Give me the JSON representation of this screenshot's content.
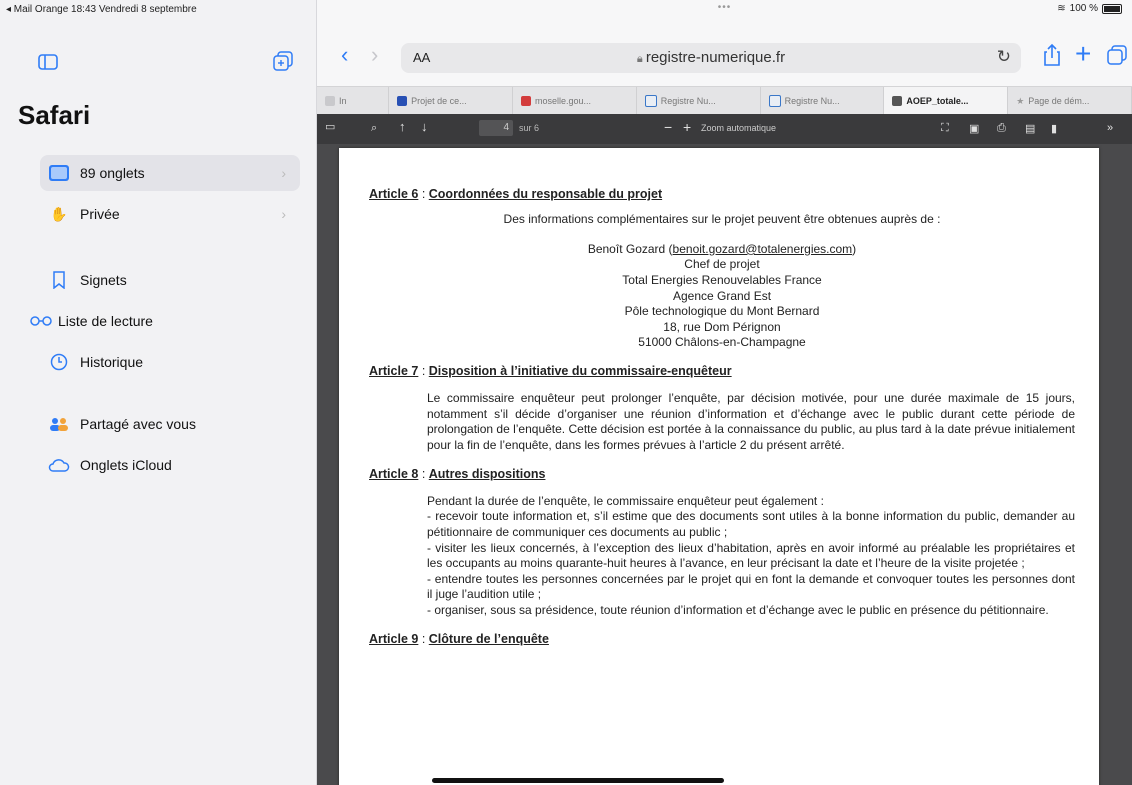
{
  "status": {
    "left": "◂ Mail Orange  18:43  Vendredi 8 septembre",
    "dots": "•••",
    "battery": "100 %"
  },
  "sidebar": {
    "title": "Safari",
    "items": [
      {
        "label": "89 onglets",
        "icon": "tabs-icon",
        "chevron": "›"
      },
      {
        "label": "Privée",
        "icon": "hand-icon",
        "chevron": "›"
      },
      {
        "label": "Signets",
        "icon": "bookmark-icon"
      },
      {
        "label": "Liste de lecture",
        "icon": "glasses-icon"
      },
      {
        "label": "Historique",
        "icon": "clock-icon"
      },
      {
        "label": "Partagé avec vous",
        "icon": "people-icon"
      },
      {
        "label": "Onglets iCloud",
        "icon": "cloud-icon"
      }
    ]
  },
  "toolbar": {
    "aa": "AA",
    "url": "registre-numerique.fr"
  },
  "tabs": [
    "In",
    "Projet de ce...",
    "moselle.gou...",
    "Registre Nu...",
    "Registre Nu...",
    "AOEP_totale...",
    "Page de dém..."
  ],
  "pdf": {
    "page_total": "sur 6",
    "page_current": "4",
    "zoom_label": "Zoom automatique",
    "zoom_minus": "−",
    "zoom_plus": "+"
  },
  "doc": {
    "art6": {
      "label": "Article 6",
      "title": "Coordonnées du responsable du projet",
      "intro": "Des informations complémentaires sur le projet peuvent être obtenues auprès de :",
      "contact": [
        "Benoît Gozard (",
        "benoit.gozard@totalenergies.com",
        ")"
      ],
      "lines": [
        "Chef de projet",
        "Total Energies Renouvelables France",
        "Agence Grand Est",
        "Pôle technologique du Mont Bernard",
        "18, rue Dom Pérignon",
        "51000 Châlons-en-Champagne"
      ]
    },
    "art7": {
      "label": "Article 7",
      "title": "Disposition à l’initiative du commissaire-enquêteur",
      "text": "Le commissaire enquêteur peut prolonger l’enquête, par décision motivée, pour une durée maximale de 15 jours, notamment s’il décide d’organiser une réunion d’information et d’échange avec le public durant cette période de prolongation de l’enquête. Cette décision est portée à la connaissance du public, au plus tard à la date prévue initialement pour la fin de l’enquête, dans les formes prévues à l’article 2 du présent arrêté."
    },
    "art8": {
      "label": "Article 8",
      "title": "Autres dispositions",
      "lines": [
        "Pendant la durée de l’enquête, le commissaire enquêteur peut également :",
        "- recevoir toute information et, s’il estime que des documents sont utiles à la bonne information du public, demander au pétitionnaire de communiquer ces documents au public ;",
        "- visiter les lieux concernés, à l’exception des lieux d’habitation, après en avoir informé au préalable les propriétaires et les occupants au moins quarante-huit heures à l’avance, en leur précisant la date et l’heure de la visite projetée ;",
        "- entendre toutes les personnes concernées par le projet qui en font la demande et convoquer toutes les personnes dont il juge l’audition utile ;",
        "- organiser, sous sa présidence, toute réunion d’information et d’échange avec le public en présence du pétitionnaire."
      ]
    },
    "art9": {
      "label": "Article 9",
      "title": "Clôture de l’enquête"
    }
  }
}
